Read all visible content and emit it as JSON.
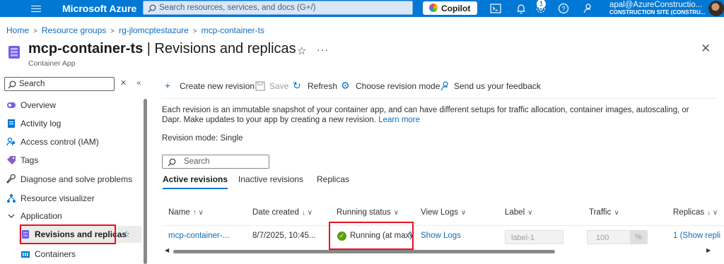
{
  "topbar": {
    "brand": "Microsoft Azure",
    "search_placeholder": "Search resources, services, and docs (G+/)",
    "copilot_label": "Copilot",
    "notification_count": "1",
    "user_name": "apal@AzureConstructio...",
    "user_directory": "CONSTRUCTION SITE (CONSTRU...",
    "icons": [
      "hamburger-icon",
      "cloud-shell-icon",
      "notifications-icon",
      "settings-icon",
      "help-icon",
      "feedback-icon"
    ],
    "accent_color": "#0078d4"
  },
  "breadcrumb": [
    "Home",
    "Resource groups",
    "rg-jlomcptestazure",
    "mcp-container-ts"
  ],
  "page": {
    "resource_name": "mcp-container-ts",
    "blade_title": " | Revisions and replicas",
    "resource_type": "Container App"
  },
  "sidebar": {
    "search_placeholder": "Search",
    "items": [
      {
        "label": "Overview",
        "icon": "overview-icon"
      },
      {
        "label": "Activity log",
        "icon": "activity-log-icon"
      },
      {
        "label": "Access control (IAM)",
        "icon": "iam-icon"
      },
      {
        "label": "Tags",
        "icon": "tag-icon"
      },
      {
        "label": "Diagnose and solve problems",
        "icon": "wrench-icon"
      },
      {
        "label": "Resource visualizer",
        "icon": "resource-visualizer-icon"
      },
      {
        "label": "Application",
        "icon": "chevron-down-icon"
      },
      {
        "label": "Revisions and replicas",
        "icon": "revisions-icon"
      },
      {
        "label": "Containers",
        "icon": "containers-icon"
      }
    ]
  },
  "commands": {
    "create": "Create new revision",
    "save": "Save",
    "refresh": "Refresh",
    "choose_mode": "Choose revision mode",
    "feedback": "Send us your feedback"
  },
  "content": {
    "description": "Each revision is an immutable snapshot of your container app, and can have different setups for traffic allocation, container images, autoscaling, or Dapr. Make updates to your app by creating a new revision.",
    "learn_more": "Learn more",
    "revision_mode_label": "Revision mode: ",
    "revision_mode_value": "Single",
    "search_placeholder": "Search",
    "tabs": [
      "Active revisions",
      "Inactive revisions",
      "Replicas"
    ]
  },
  "table": {
    "columns": [
      {
        "label": "Name",
        "sort": "↑ ∨"
      },
      {
        "label": "Date created",
        "sort": "↓ ∨"
      },
      {
        "label": "Running status",
        "sort": "∨"
      },
      {
        "label": "View Logs",
        "sort": "∨"
      },
      {
        "label": "Label",
        "sort": "∨"
      },
      {
        "label": "Traffic",
        "sort": "∨"
      },
      {
        "label": "Replicas",
        "sort": "↓ ∨"
      }
    ],
    "rows": [
      {
        "name": "mcp-container-...",
        "date_created": "8/7/2025, 10:45...",
        "running_status": "Running (at max)",
        "running_status_suffix": "V",
        "view_logs": "Show Logs",
        "label_placeholder": "label-1",
        "traffic": "100",
        "traffic_unit": "%",
        "replicas": "1 (Show repli"
      }
    ]
  }
}
